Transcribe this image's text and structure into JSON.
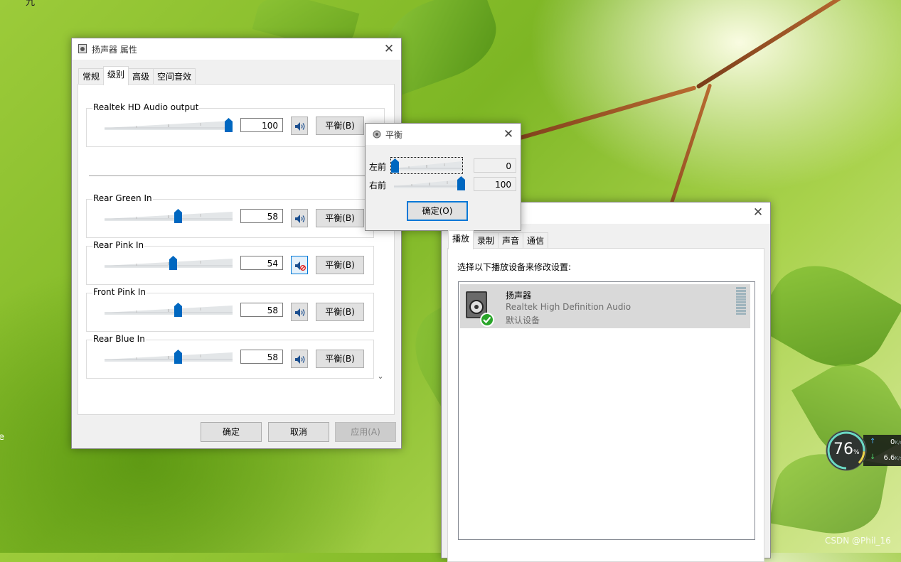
{
  "desktop": {
    "corner_text": "九",
    "edge_text": "e",
    "watermark": "CSDN @Phil_16"
  },
  "props_window": {
    "title": "扬声器 属性",
    "tabs": [
      "常规",
      "级别",
      "高级",
      "空间音效"
    ],
    "active_tab": 1,
    "master": {
      "label": "Realtek HD Audio output",
      "value": "100",
      "balance_label": "平衡(B)",
      "level": 1.0
    },
    "channels": [
      {
        "label": "Rear Green In",
        "value": "58",
        "balance_label": "平衡(B)",
        "level": 0.58,
        "muted": false
      },
      {
        "label": "Rear Pink In",
        "value": "54",
        "balance_label": "平衡(B)",
        "level": 0.54,
        "muted": true
      },
      {
        "label": "Front Pink In",
        "value": "58",
        "balance_label": "平衡(B)",
        "level": 0.58,
        "muted": false
      },
      {
        "label": "Rear Blue In",
        "value": "58",
        "balance_label": "平衡(B)",
        "level": 0.58,
        "muted": false
      }
    ],
    "buttons": {
      "ok": "确定",
      "cancel": "取消",
      "apply": "应用(A)"
    }
  },
  "balance_dialog": {
    "title": "平衡",
    "rows": [
      {
        "label": "左前",
        "value": "0",
        "level": 0.0
      },
      {
        "label": "右前",
        "value": "100",
        "level": 1.0
      }
    ],
    "ok_label": "确定(O)"
  },
  "sound_window": {
    "tabs": [
      "播放",
      "录制",
      "声音",
      "通信"
    ],
    "active_tab": 0,
    "instruction": "选择以下播放设备来修改设置:",
    "device": {
      "name": "扬声器",
      "driver": "Realtek High Definition Audio",
      "status": "默认设备"
    }
  },
  "net_monitor": {
    "percent": "76",
    "percent_unit": "%",
    "upload": "0",
    "upload_unit": "K/s",
    "download": "6.6",
    "download_unit": "K/s"
  },
  "colors": {
    "accent": "#0078d7",
    "thumb": "#0067c0",
    "ok_green": "#2aa52a"
  }
}
